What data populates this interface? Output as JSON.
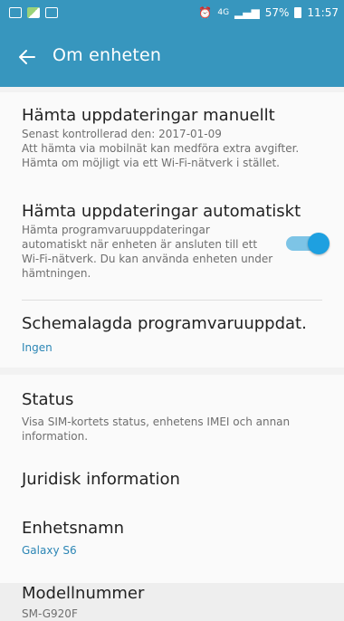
{
  "status_bar": {
    "signal_text": "4G",
    "battery": "57%",
    "time": "11:57"
  },
  "app_bar": {
    "title": "Om enheten"
  },
  "items": [
    {
      "title": "Hämta uppdateringar manuellt",
      "line1": "Senast kontrollerad den: 2017-01-09",
      "line2": "Att hämta via mobilnät kan medföra extra avgifter.",
      "line3": "Hämta om möjligt via ett Wi-Fi-nätverk i stället."
    },
    {
      "title": "Hämta uppdateringar automatiskt",
      "line1": "Hämta programvaruuppdateringar",
      "line2": "automatiskt när enheten är ansluten till ett",
      "line3": "Wi-Fi-nätverk. Du kan använda enheten under",
      "line4": "hämtningen.",
      "toggle_on": true
    },
    {
      "title": "Schemalagda programvaruuppdat.",
      "value": "Ingen"
    },
    {
      "title": "Status",
      "line1": "Visa SIM-kortets status, enhetens IMEI och annan",
      "line2": "information."
    },
    {
      "title": "Juridisk information"
    },
    {
      "title": "Enhetsnamn",
      "value": "Galaxy S6"
    },
    {
      "title": "Modellnummer",
      "value": "SM-G920F"
    }
  ],
  "colors": {
    "accent": "#3796be",
    "link": "#2c86b5"
  }
}
